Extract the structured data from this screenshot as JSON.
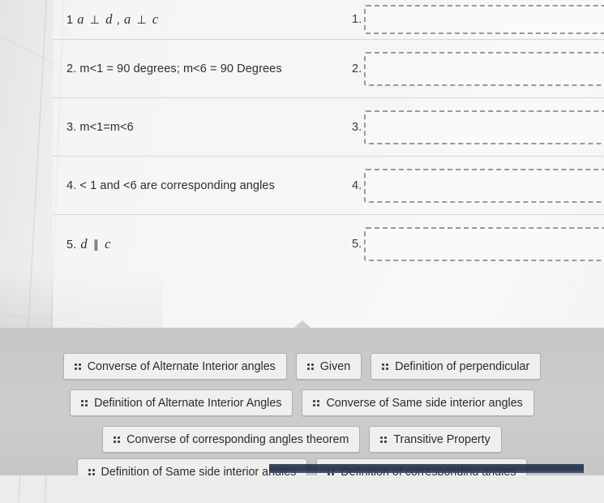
{
  "proof": {
    "rows": [
      {
        "index": "1",
        "statement_html": "1 <i class=\"mathvar\">a</i> <span class=\"op\">⊥</span> <i class=\"mathvar\">d</i> , <i class=\"mathvar\">a</i> <span class=\"op\">⊥</span> <i class=\"mathvar\">c</i>",
        "statement_text": "1 a ⊥ d , a ⊥ c",
        "reason_index": "1.",
        "reason_value": "",
        "reason_placeholder": ""
      },
      {
        "index": "2",
        "statement_html": "2. m&lt;1 = 90 degrees; m&lt;6 = 90 Degrees",
        "statement_text": "2. m<1 = 90 degrees; m<6 = 90 Degrees",
        "reason_index": "2.",
        "reason_value": "",
        "reason_placeholder": ""
      },
      {
        "index": "3",
        "statement_html": "3. m&lt;1=m&lt;6",
        "statement_text": "3. m<1=m<6",
        "reason_index": "3.",
        "reason_value": "",
        "reason_placeholder": ""
      },
      {
        "index": "4",
        "statement_html": "4. &lt; 1 and &lt;6 are corresponding angles",
        "statement_text": "4. < 1 and <6 are corresponding angles",
        "reason_index": "4.",
        "reason_value": "",
        "reason_placeholder": ""
      },
      {
        "index": "5",
        "statement_html": "5. <i class=\"mathvar\">d</i> <span class=\"op\">∥</span> <i class=\"mathvar\">c</i>",
        "statement_text": "5. d ∥ c",
        "reason_index": "5.",
        "reason_value": "",
        "reason_placeholder": ""
      }
    ]
  },
  "answer_bank": {
    "grabber_icon": "triangle-up-icon",
    "grip_icon": "drag-handle-icon",
    "rows": [
      [
        "Converse of Alternate Interior angles",
        "Given",
        "Definition of perpendicular"
      ],
      [
        "Definition of Alternate Interior Angles",
        "Converse of Same side interior angles"
      ],
      [
        "Converse of corresponding angles theorem",
        "Transitive Property"
      ],
      [
        "Definition of Same side interior angles",
        "Definition of corresponding angles"
      ]
    ]
  },
  "colors": {
    "page_background": "#f2f2f0",
    "bank_background": "#c9c9c9",
    "chip_background": "#efefed",
    "chip_border": "#b0b0ae",
    "dropzone_border": "#9a9a98",
    "row_divider": "#d6d6d4",
    "text": "#2e2e2e",
    "bottom_strip": "#2b3b55"
  }
}
